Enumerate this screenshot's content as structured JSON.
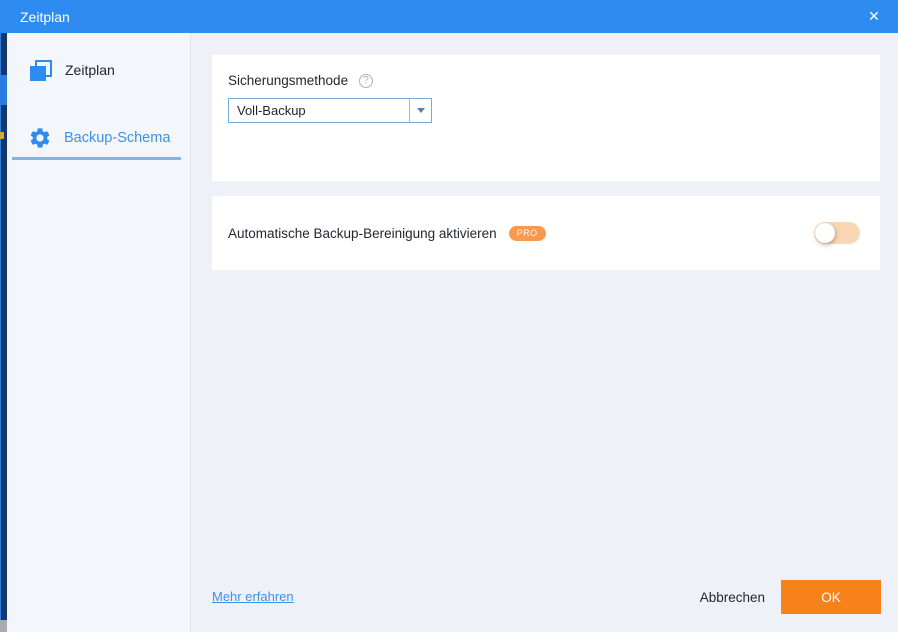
{
  "window": {
    "title": "Zeitplan",
    "close_glyph": "✕"
  },
  "sidebar": {
    "items": [
      {
        "label": "Zeitplan",
        "icon": "layers-icon",
        "active": false
      },
      {
        "label": "Backup-Schema",
        "icon": "gear-icon",
        "active": true
      }
    ]
  },
  "main": {
    "backup_method": {
      "label": "Sicherungsmethode",
      "help_glyph": "?",
      "value": "Voll-Backup"
    },
    "auto_cleanup": {
      "label": "Automatische Backup-Bereinigung aktivieren",
      "badge": "PRO",
      "enabled": false,
      "toggle_state": "off"
    }
  },
  "footer": {
    "learn_more": "Mehr erfahren",
    "cancel": "Abbrechen",
    "ok": "OK"
  },
  "colors": {
    "titlebar_blue": "#2e8bf0",
    "accent_blue": "#3f90e8",
    "icon_blue": "#2d8cf0",
    "active_underline": "#7fb3ef",
    "dropdown_border": "#7ea6d6",
    "ok_orange": "#f8821a",
    "badge_orange": "#f9994d",
    "toggle_track": "#f9d7b5",
    "sidebar_bg": "#f3f6fb",
    "main_bg": "#eef2f8",
    "edge_navy": "#16376e"
  }
}
